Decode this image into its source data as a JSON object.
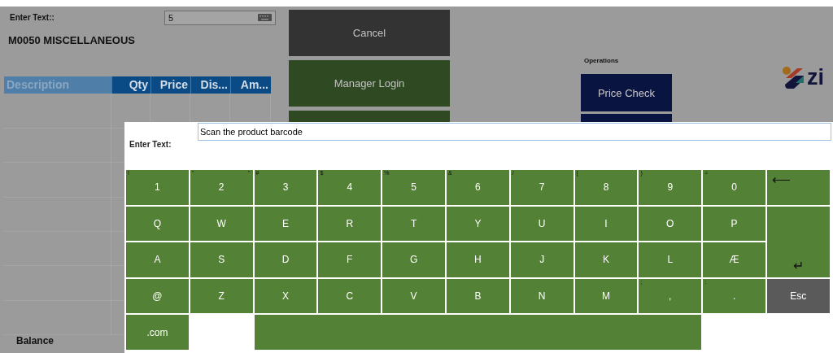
{
  "background": {
    "entry": {
      "label": "Enter Text::",
      "value": "5"
    },
    "item_title": "M0050 MISCELLANEOUS",
    "table": {
      "columns": [
        {
          "label": "Description",
          "selected": true
        },
        {
          "label": "Qty",
          "selected": false
        },
        {
          "label": "Price",
          "selected": false
        },
        {
          "label": "Dis...",
          "selected": false
        },
        {
          "label": "Am...",
          "selected": false
        }
      ]
    },
    "balance_label": "Balance",
    "action_buttons": [
      {
        "label": "Cancel",
        "kind": "dark"
      },
      {
        "label": "Manager Login",
        "kind": "green"
      },
      {
        "kind": "green"
      }
    ],
    "operations": {
      "title": "Operations",
      "buttons": [
        {
          "label": "Price Check",
          "kind": "navy"
        },
        {
          "kind": "navy"
        }
      ]
    },
    "logo_text": "zi"
  },
  "dialog": {
    "label": "Enter Text:",
    "value": "Scan the product barcode",
    "keys": [
      {
        "kind": "char",
        "label": "1",
        "shift": "!"
      },
      {
        "kind": "char",
        "label": "2",
        "shift": "\"",
        "alt": "\""
      },
      {
        "kind": "char",
        "label": "3",
        "shift": "#"
      },
      {
        "kind": "char",
        "label": "4",
        "shift": "$"
      },
      {
        "kind": "char",
        "label": "5",
        "shift": "%"
      },
      {
        "kind": "char",
        "label": "6",
        "shift": "&"
      },
      {
        "kind": "char",
        "label": "7",
        "shift": "/"
      },
      {
        "kind": "char",
        "label": "8",
        "shift": "("
      },
      {
        "kind": "char",
        "label": "9",
        "shift": ")"
      },
      {
        "kind": "char",
        "label": "0",
        "shift": "="
      },
      {
        "kind": "backspace",
        "label": "⟵"
      },
      {
        "kind": "char",
        "label": "Q"
      },
      {
        "kind": "char",
        "label": "W"
      },
      {
        "kind": "char",
        "label": "E"
      },
      {
        "kind": "char",
        "label": "R"
      },
      {
        "kind": "char",
        "label": "T"
      },
      {
        "kind": "char",
        "label": "Y"
      },
      {
        "kind": "char",
        "label": "U"
      },
      {
        "kind": "char",
        "label": "I"
      },
      {
        "kind": "char",
        "label": "O"
      },
      {
        "kind": "char",
        "label": "P"
      },
      {
        "kind": "enter",
        "label": "↵"
      },
      {
        "kind": "char",
        "label": "A"
      },
      {
        "kind": "char",
        "label": "S"
      },
      {
        "kind": "char",
        "label": "D"
      },
      {
        "kind": "char",
        "label": "F"
      },
      {
        "kind": "char",
        "label": "G"
      },
      {
        "kind": "char",
        "label": "H"
      },
      {
        "kind": "char",
        "label": "J"
      },
      {
        "kind": "char",
        "label": "K"
      },
      {
        "kind": "char",
        "label": "L"
      },
      {
        "kind": "char",
        "label": "Æ"
      },
      {
        "kind": "char",
        "label": "@"
      },
      {
        "kind": "char",
        "label": "Z"
      },
      {
        "kind": "char",
        "label": "X"
      },
      {
        "kind": "char",
        "label": "C"
      },
      {
        "kind": "char",
        "label": "V"
      },
      {
        "kind": "char",
        "label": "B"
      },
      {
        "kind": "char",
        "label": "N"
      },
      {
        "kind": "char",
        "label": "M"
      },
      {
        "kind": "char",
        "label": ",",
        "shift": ";"
      },
      {
        "kind": "char",
        "label": ".",
        "shift": ":"
      },
      {
        "kind": "esc",
        "label": "Esc"
      },
      {
        "kind": "char",
        "label": ".com"
      },
      {
        "kind": "blank"
      },
      {
        "kind": "space"
      }
    ]
  }
}
